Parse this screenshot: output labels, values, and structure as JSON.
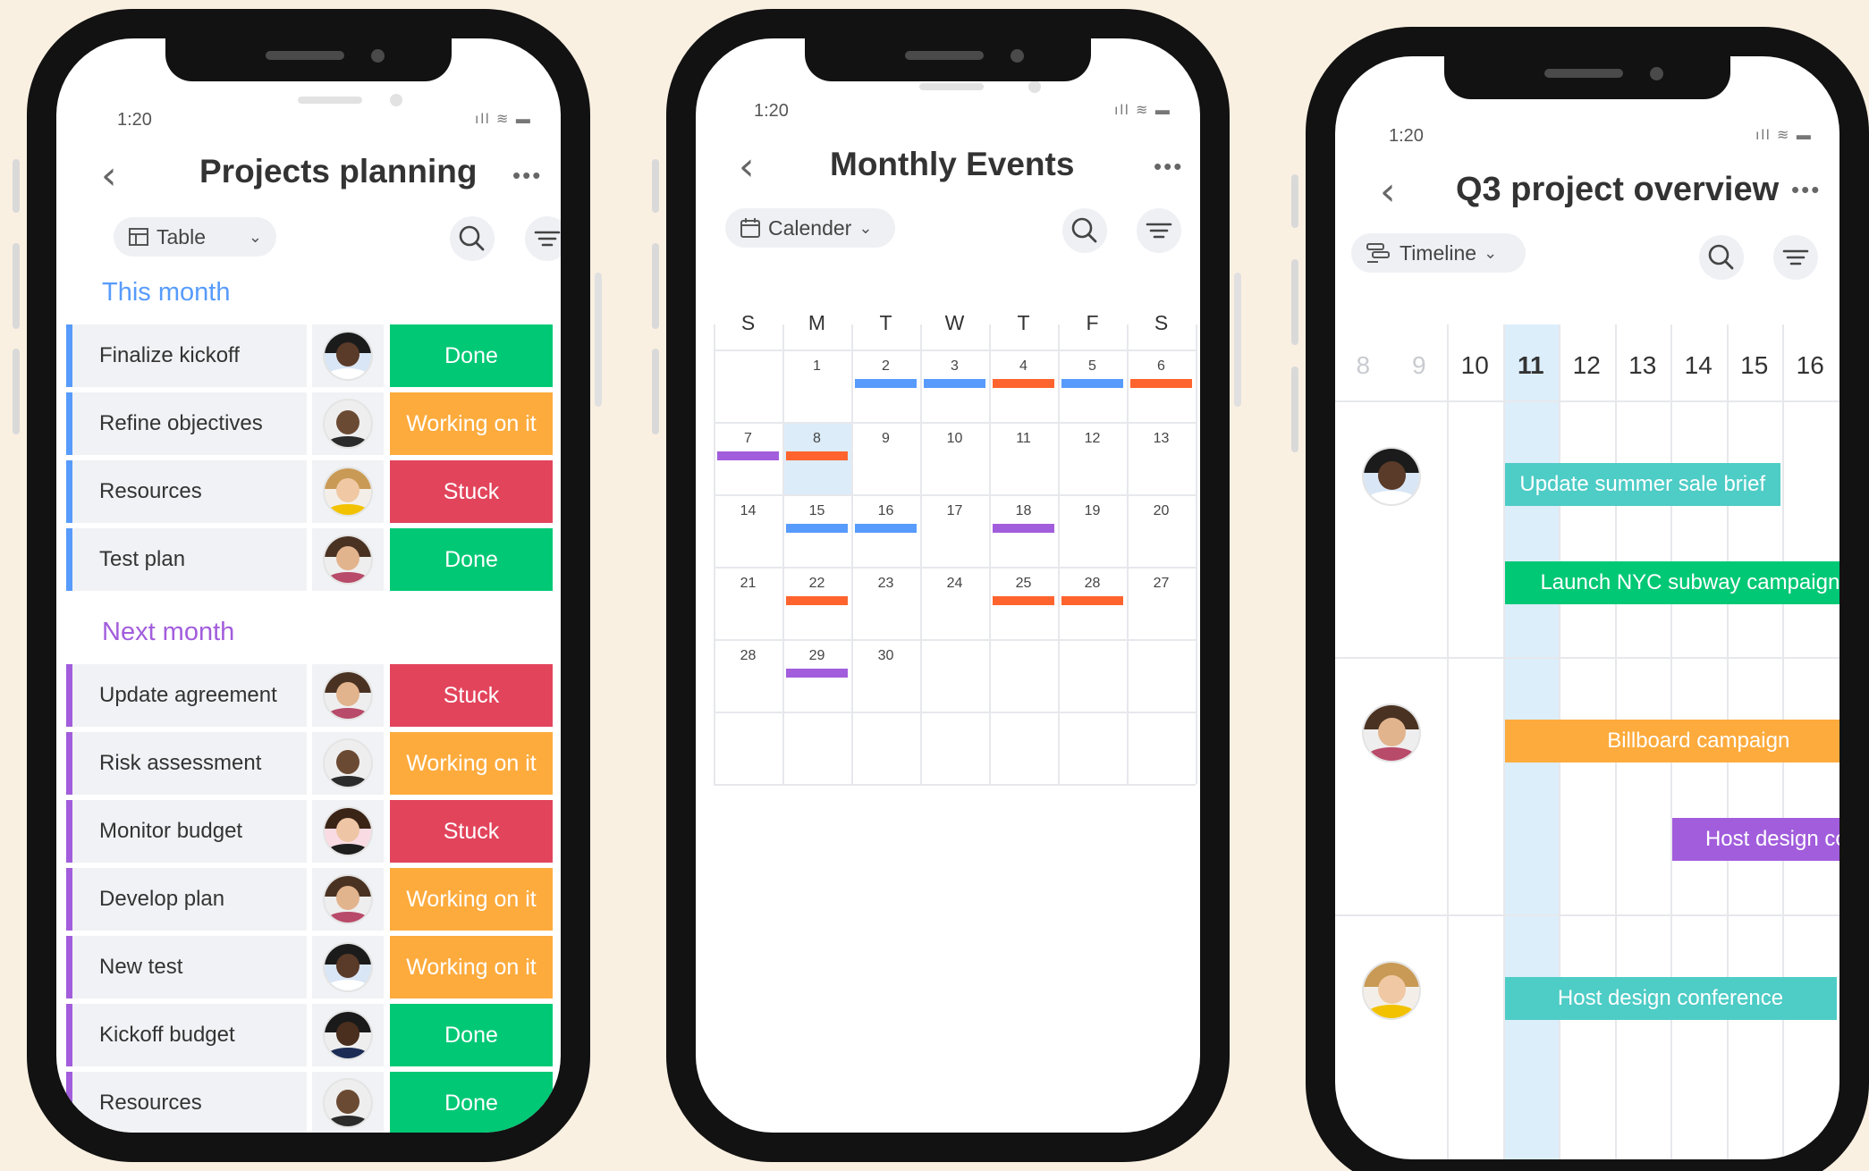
{
  "colors": {
    "done": "#00c875",
    "working": "#fdab3d",
    "stuck": "#e2445c",
    "blue": "#579bfc",
    "purple": "#a25ddc",
    "orange": "#ff642e",
    "teal": "#4eccc6",
    "this_month": "#579bfc",
    "next_month": "#a25ddc"
  },
  "phone1": {
    "time": "1:20",
    "title": "Projects planning",
    "more_label": "•••",
    "view_label": "Table",
    "groups": [
      {
        "title": "This month",
        "items": [
          {
            "name": "Finalize kickoff",
            "status": "Done",
            "avatar": "woman-dark"
          },
          {
            "name": "Refine objectives",
            "status": "Working on it",
            "avatar": "man-bald"
          },
          {
            "name": "Resources",
            "status": "Stuck",
            "avatar": "woman-blonde"
          },
          {
            "name": "Test plan",
            "status": "Done",
            "avatar": "man-beard"
          }
        ]
      },
      {
        "title": "Next month",
        "items": [
          {
            "name": "Update agreement",
            "status": "Stuck",
            "avatar": "man-beard"
          },
          {
            "name": "Risk assessment",
            "status": "Working on it",
            "avatar": "man-bald"
          },
          {
            "name": "Monitor budget",
            "status": "Stuck",
            "avatar": "woman-brunette"
          },
          {
            "name": "Develop plan",
            "status": "Working on it",
            "avatar": "man-beard"
          },
          {
            "name": "New test",
            "status": "Working on it",
            "avatar": "woman-dark"
          },
          {
            "name": "Kickoff budget",
            "status": "Done",
            "avatar": "man-dark"
          },
          {
            "name": "Resources",
            "status": "Done",
            "avatar": "man-bald"
          }
        ]
      }
    ]
  },
  "phone2": {
    "time": "1:20",
    "title": "Monthly Events",
    "more_label": "•••",
    "view_label": "Calender",
    "weekdays": [
      "S",
      "M",
      "T",
      "W",
      "T",
      "F",
      "S"
    ],
    "weeks": [
      [
        "",
        "1",
        "2",
        "3",
        "4",
        "5",
        "6"
      ],
      [
        "7",
        "8",
        "9",
        "10",
        "11",
        "12",
        "13"
      ],
      [
        "14",
        "15",
        "16",
        "17",
        "18",
        "19",
        "20"
      ],
      [
        "21",
        "22",
        "23",
        "24",
        "25",
        "28",
        "27"
      ],
      [
        "28",
        "29",
        "30",
        "",
        "",
        "",
        ""
      ]
    ],
    "events": [
      {
        "week": 0,
        "day": 2,
        "color": "blue"
      },
      {
        "week": 0,
        "day": 3,
        "color": "blue"
      },
      {
        "week": 0,
        "day": 4,
        "color": "orange"
      },
      {
        "week": 0,
        "day": 5,
        "color": "blue"
      },
      {
        "week": 0,
        "day": 6,
        "color": "orange"
      },
      {
        "week": 1,
        "day": 0,
        "color": "purple"
      },
      {
        "week": 1,
        "day": 1,
        "color": "orange"
      },
      {
        "week": 2,
        "day": 1,
        "color": "blue"
      },
      {
        "week": 2,
        "day": 2,
        "color": "blue"
      },
      {
        "week": 2,
        "day": 4,
        "color": "purple"
      },
      {
        "week": 3,
        "day": 1,
        "color": "orange"
      },
      {
        "week": 3,
        "day": 4,
        "color": "orange"
      },
      {
        "week": 3,
        "day": 5,
        "color": "orange"
      },
      {
        "week": 4,
        "day": 1,
        "color": "purple"
      }
    ],
    "selected": {
      "week": 1,
      "day": 1
    }
  },
  "phone3": {
    "time": "1:20",
    "title": "Q3 project overview",
    "more_label": "•••",
    "view_label": "Timeline",
    "days": [
      "8",
      "9",
      "10",
      "11",
      "12",
      "13",
      "14",
      "15",
      "16"
    ],
    "faded_days": 2,
    "today_index": 3,
    "lanes": [
      {
        "avatar": "woman-dark",
        "tasks": [
          {
            "label": "Update summer sale brief",
            "color": "teal",
            "start": 3,
            "span": 5
          },
          {
            "label": "Launch NYC subway campaign",
            "color": "done",
            "start": 3,
            "span": 6.7
          }
        ]
      },
      {
        "avatar": "man-beard",
        "tasks": [
          {
            "label": "Billboard campaign",
            "color": "working",
            "start": 3,
            "span": 7
          },
          {
            "label": "Host design con",
            "color": "purple",
            "start": 6,
            "span": 4
          }
        ]
      },
      {
        "avatar": "woman-blonde",
        "tasks": [
          {
            "label": "Host design conference",
            "color": "teal",
            "start": 3,
            "span": 6
          }
        ]
      }
    ]
  }
}
